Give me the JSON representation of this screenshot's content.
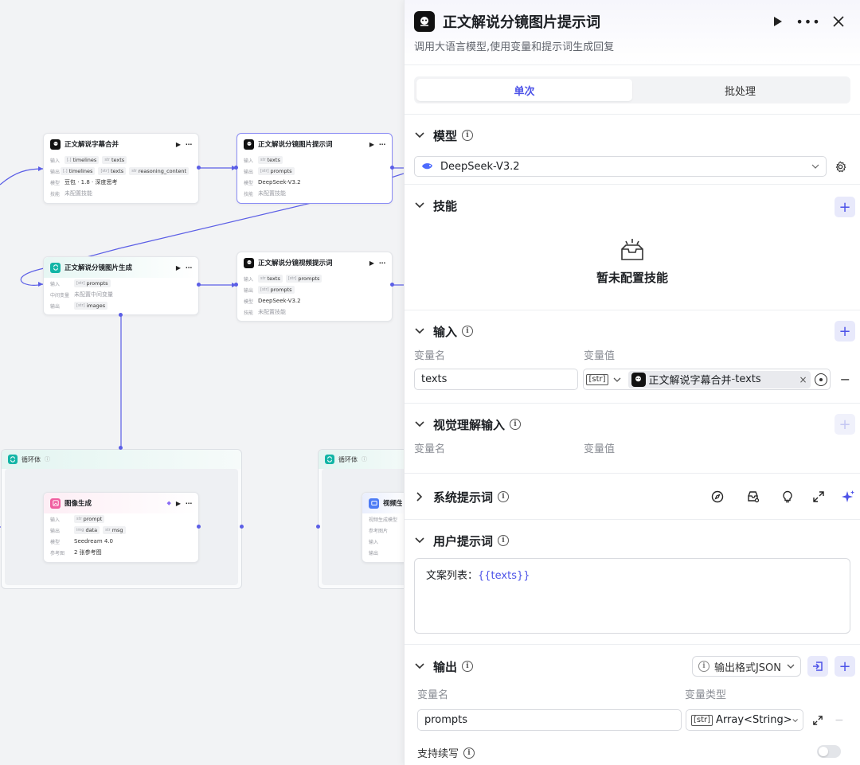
{
  "canvas": {
    "nodes": {
      "merge": {
        "title": "正文解说字幕合并",
        "rows": [
          {
            "label": "输入",
            "chips": [
              {
                "t": "[.]",
                "v": "timelines"
              },
              {
                "t": "str",
                "v": "texts"
              }
            ]
          },
          {
            "label": "输出",
            "chips": [
              {
                "t": "[.]",
                "v": "timelines"
              },
              {
                "t": "[str]",
                "v": "texts"
              },
              {
                "t": "str",
                "v": "reasoning_content"
              }
            ]
          },
          {
            "label": "模型",
            "text": "豆包 · 1.8 · 深度思考"
          },
          {
            "label": "技能",
            "text": "未配置技能"
          }
        ]
      },
      "prompt_img": {
        "title": "正文解说分镜图片提示词",
        "rows": [
          {
            "label": "输入",
            "chips": [
              {
                "t": "str",
                "v": "texts"
              }
            ]
          },
          {
            "label": "输出",
            "chips": [
              {
                "t": "[str]",
                "v": "prompts"
              }
            ]
          },
          {
            "label": "模型",
            "text": "DeepSeek-V3.2"
          },
          {
            "label": "技能",
            "text": "未配置技能"
          }
        ]
      },
      "gen_img": {
        "title": "正文解说分镜图片生成",
        "rows": [
          {
            "label": "输入",
            "chips": [
              {
                "t": "[str]",
                "v": "prompts"
              }
            ]
          },
          {
            "label": "中间变量",
            "text": "未配置中间变量"
          },
          {
            "label": "输出",
            "chips": [
              {
                "t": "[str]",
                "v": "images"
              }
            ]
          }
        ]
      },
      "prompt_vid": {
        "title": "正文解说分镜视频提示词",
        "rows": [
          {
            "label": "输入",
            "chips": [
              {
                "t": "str",
                "v": "texts"
              },
              {
                "t": "[str]",
                "v": "prompts"
              }
            ]
          },
          {
            "label": "输出",
            "chips": [
              {
                "t": "[str]",
                "v": "prompts"
              }
            ]
          },
          {
            "label": "模型",
            "text": "DeepSeek-V3.2"
          },
          {
            "label": "技能",
            "text": "未配置技能"
          }
        ]
      },
      "image_gen": {
        "title": "图像生成",
        "rows": [
          {
            "label": "输入",
            "chips": [
              {
                "t": "str",
                "v": "prompt"
              }
            ]
          },
          {
            "label": "输出",
            "chips": [
              {
                "t": "img",
                "v": "data"
              },
              {
                "t": "str",
                "v": "msg"
              }
            ]
          },
          {
            "label": "模型",
            "text": "Seedream 4.0"
          },
          {
            "label": "参考图",
            "text": "2 张参考图"
          }
        ]
      },
      "video_gen": {
        "title": "视频生",
        "rows": [
          {
            "label": "视频生成模型",
            "text": ""
          },
          {
            "label": "参考图片",
            "text": ""
          },
          {
            "label": "输入",
            "text": ""
          },
          {
            "label": "输出",
            "text": ""
          }
        ]
      }
    },
    "loop1": "循环体",
    "loop2": "循环体"
  },
  "panel": {
    "title": "正文解说分镜图片提示词",
    "description": "调用大语言模型,使用变量和提示词生成回复",
    "tabs": [
      "单次",
      "批处理"
    ],
    "model": {
      "label": "模型",
      "value": "DeepSeek-V3.2"
    },
    "skills": {
      "label": "技能",
      "empty": "暂未配置技能"
    },
    "input": {
      "label": "输入",
      "col_name": "变量名",
      "col_value": "变量值",
      "var_name": "texts",
      "type_tag": "[str]",
      "ref_node": "正文解说字幕合并",
      "ref_sep": " - ",
      "ref_var": "texts"
    },
    "vision": {
      "label": "视觉理解输入",
      "col_name": "变量名",
      "col_value": "变量值"
    },
    "system_prompt": {
      "label": "系统提示词"
    },
    "user_prompt": {
      "label": "用户提示词",
      "text_prefix": "文案列表：",
      "text_var": "{{texts}}"
    },
    "output": {
      "label": "输出",
      "format": "输出格式JSON",
      "col_name": "变量名",
      "col_type": "变量类型",
      "var_name": "prompts",
      "type_tag": "[str]",
      "type_value": "Array<String>",
      "continue_label": "支持续写"
    },
    "colors": {
      "accent": "#4d53e8",
      "edge": "#5b5ee6"
    }
  }
}
